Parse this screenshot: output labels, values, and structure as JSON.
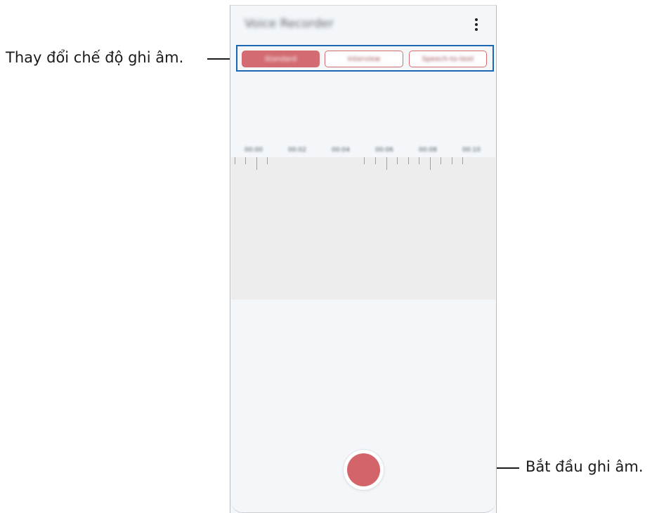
{
  "callouts": {
    "mode": "Thay đổi chế độ ghi âm.",
    "record": "Bắt đầu ghi âm."
  },
  "app": {
    "title": "Voice Recorder"
  },
  "modes": [
    {
      "label": "Standard",
      "selected": true
    },
    {
      "label": "Interview",
      "selected": false
    },
    {
      "label": "Speech-to-text",
      "selected": false
    }
  ],
  "timeline": {
    "labels": [
      "00:00",
      "00:02",
      "00:04",
      "00:06",
      "00:08",
      "00:10"
    ]
  },
  "colors": {
    "accent": "#d36469",
    "highlight_frame": "#1c67b3",
    "screen_bg": "#f3f7fa",
    "wave_area_bg": "#ededed"
  },
  "icons": {
    "more": "more-options-icon",
    "record": "record-icon"
  }
}
